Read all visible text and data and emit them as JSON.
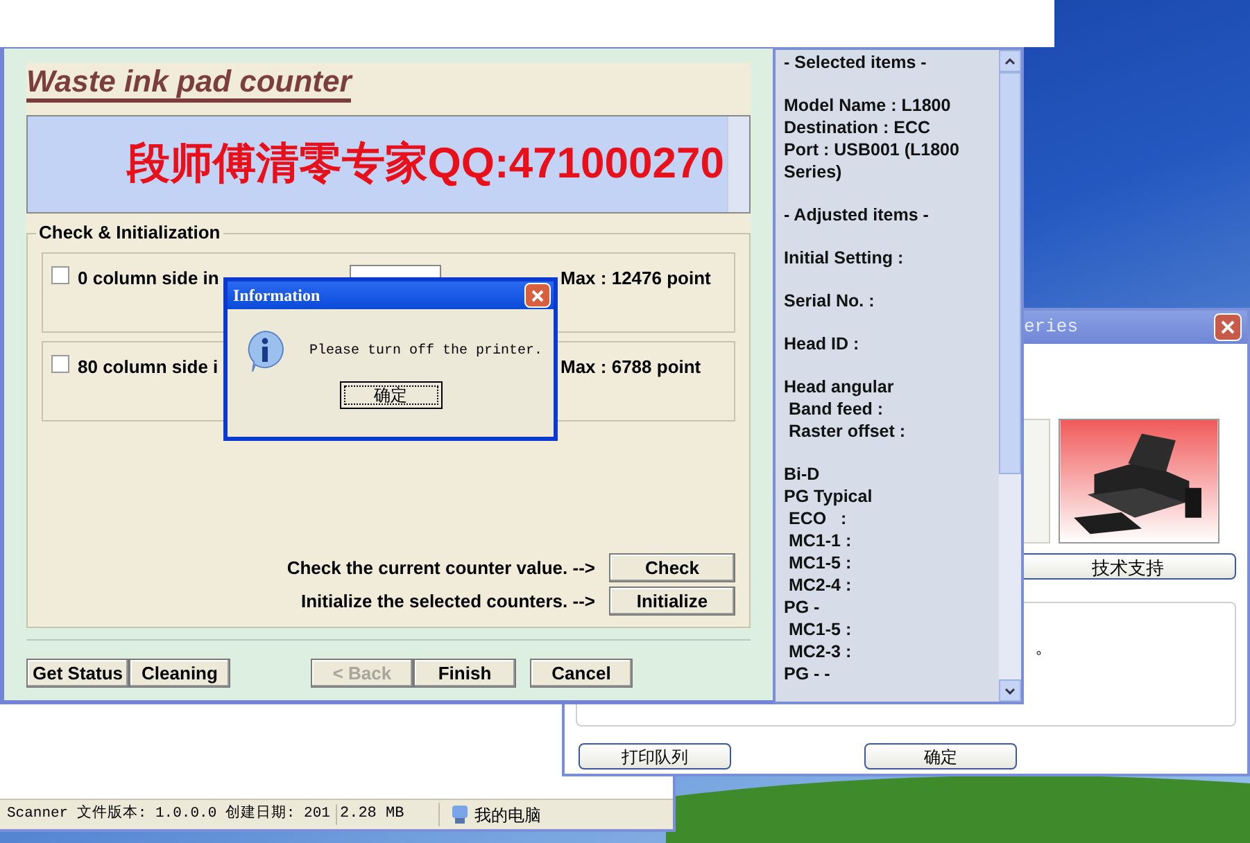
{
  "main_window": {
    "title": "Waste ink pad counter",
    "banner": "段师傅清零专家QQ:471000270",
    "group_title": "Check & Initialization",
    "counters": [
      {
        "label": "0 column side in",
        "checked": false,
        "max": "Max : 12476 point"
      },
      {
        "label": "80 column side i",
        "checked": false,
        "max": "Max : 6788 point"
      }
    ],
    "actions": [
      {
        "label": "Check the current counter value. -->",
        "button": "Check"
      },
      {
        "label": "Initialize the selected counters. -->",
        "button": "Initialize"
      }
    ],
    "buttons": [
      {
        "label": "Get Status",
        "disabled": false
      },
      {
        "label": "Cleaning",
        "disabled": false
      },
      {
        "label": "< Back",
        "disabled": true
      },
      {
        "label": "Finish",
        "disabled": false
      },
      {
        "label": "Cancel",
        "disabled": false
      }
    ]
  },
  "info_panel": {
    "groups": [
      [
        "- Selected items -"
      ],
      [
        "Model Name : L1800",
        "Destination : ECC",
        "Port : USB001 (L1800 Series)"
      ],
      [
        "- Adjusted items -"
      ],
      [
        "Initial Setting :"
      ],
      [
        "Serial No. :"
      ],
      [
        "Head ID :"
      ],
      [
        "Head angular",
        " Band feed :",
        " Raster offset :"
      ],
      [
        "Bi-D",
        "PG Typical",
        " ECO   :",
        " MC1-1 :",
        " MC1-5 :",
        " MC2-4 :",
        "PG -",
        " MC1-5 :",
        " MC2-3 :",
        "PG - -"
      ]
    ]
  },
  "dialog": {
    "title": "Information",
    "message": "Please turn off the printer.",
    "button": "确定"
  },
  "printer_window": {
    "title": "eries",
    "support_button": "技术支持",
    "note": "。",
    "buttons": [
      "打印队列",
      "确定"
    ]
  },
  "explorer_status": {
    "info": "Scanner 文件版本: 1.0.0.0 创建日期: 201",
    "size": "2.28 MB",
    "location": "我的电脑"
  }
}
